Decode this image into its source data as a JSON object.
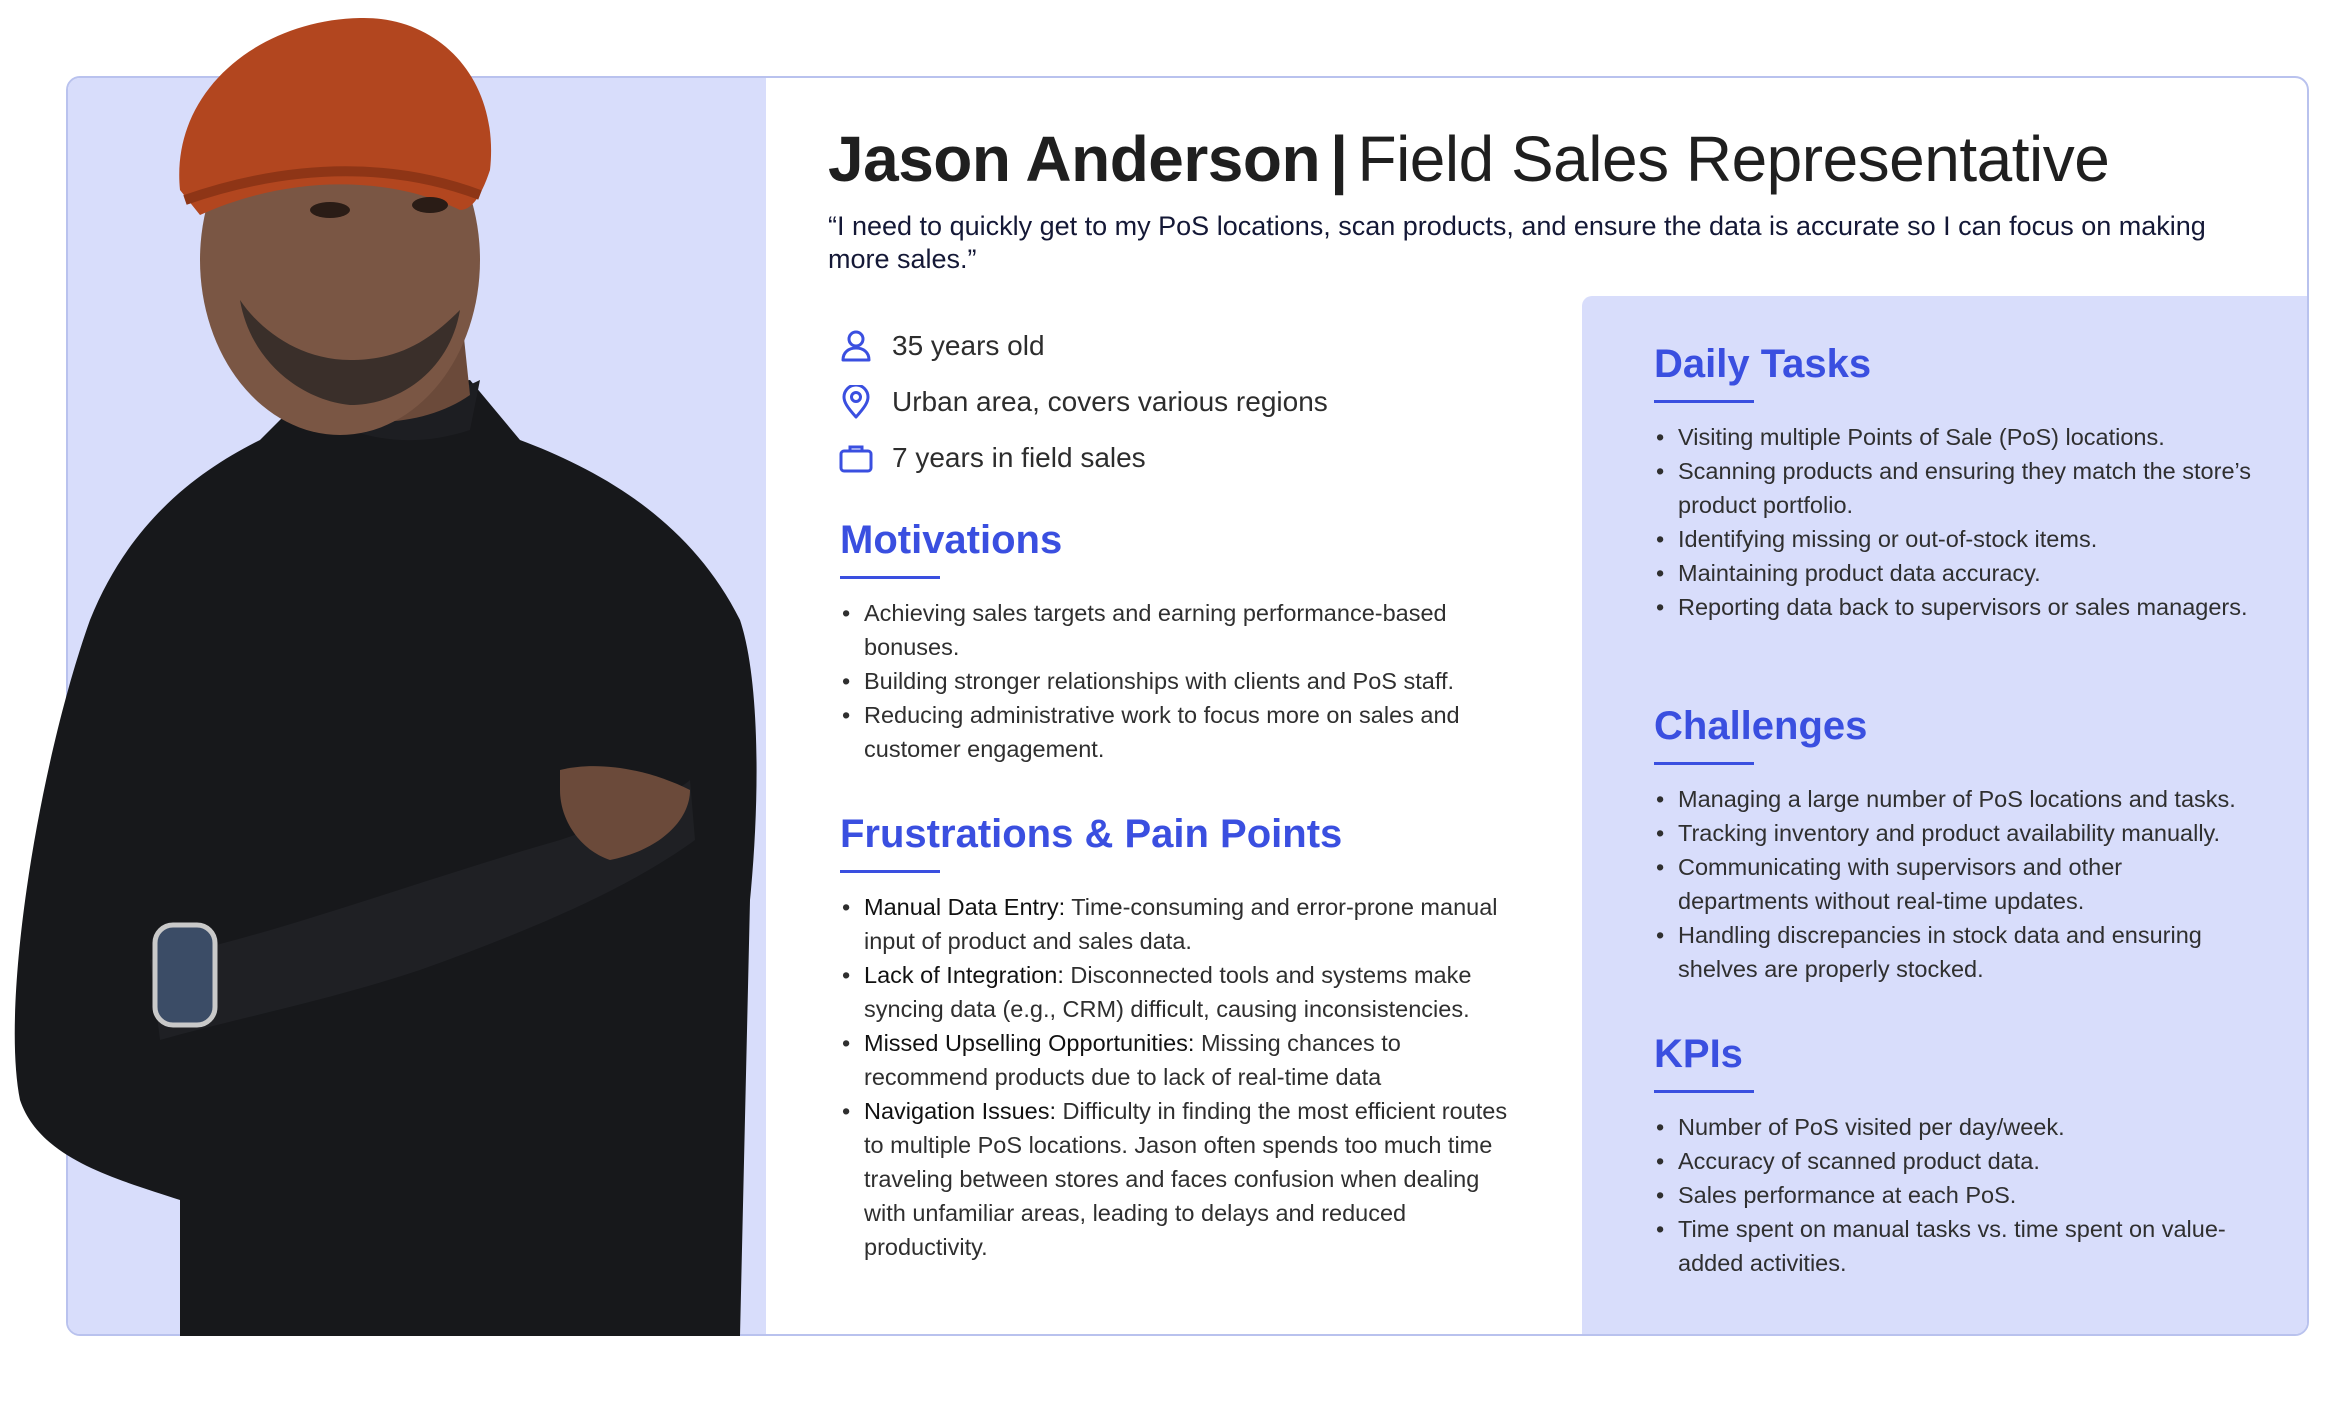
{
  "persona": {
    "name": "Jason Anderson",
    "separator": "|",
    "role": "Field Sales Representative",
    "quote": "“I need to quickly get to my PoS locations, scan products, and ensure the data is accurate so I can focus on making more sales.”"
  },
  "facts": [
    {
      "icon": "person-icon",
      "text": "35 years old"
    },
    {
      "icon": "location-pin-icon",
      "text": "Urban area, covers various regions"
    },
    {
      "icon": "briefcase-icon",
      "text": "7 years in field sales"
    }
  ],
  "motivations": {
    "title": "Motivations",
    "items": [
      "Achieving sales targets and earning performance-based bonuses.",
      "Building stronger relationships with clients and PoS staff.",
      "Reducing administrative work to focus more on sales and customer engagement."
    ]
  },
  "frustrations": {
    "title": "Frustrations & Pain Points",
    "items": [
      {
        "label": "Manual Data Entry:",
        "text": " Time-consuming and error-prone manual input of product and sales data."
      },
      {
        "label": "Lack of Integration:",
        "text": " Disconnected tools and systems make syncing data (e.g., CRM) difficult, causing inconsistencies."
      },
      {
        "label": "Missed Upselling Opportunities:",
        "text": " Missing chances to recommend products due to lack of real-time data"
      },
      {
        "label": "Navigation Issues:",
        "text": " Difficulty in finding the most efficient routes to multiple PoS locations. Jason often spends too much time traveling between stores and faces confusion when dealing with unfamiliar areas, leading to delays and reduced productivity."
      }
    ]
  },
  "daily_tasks": {
    "title": "Daily Tasks",
    "items": [
      "Visiting multiple Points of Sale (PoS) locations.",
      "Scanning products and ensuring they match the store’s product portfolio.",
      "Identifying missing or out-of-stock items.",
      "Maintaining product data accuracy.",
      "Reporting data back to supervisors or sales managers."
    ]
  },
  "challenges": {
    "title": "Challenges",
    "items": [
      "Managing a large number of PoS locations and tasks.",
      "Tracking inventory and product availability manually.",
      "Communicating with supervisors and other departments without real-time updates.",
      "Handling discrepancies in stock data and ensuring shelves are properly stocked."
    ]
  },
  "kpis": {
    "title": "KPIs",
    "items": [
      "Number of PoS visited per day/week.",
      "Accuracy of scanned product data.",
      "Sales performance at each PoS.",
      "Time spent on manual tasks vs. time spent on value-added activities."
    ]
  },
  "colors": {
    "accent": "#3a4fe0",
    "panel": "#d8ddfb",
    "border": "#b9c2ee"
  }
}
